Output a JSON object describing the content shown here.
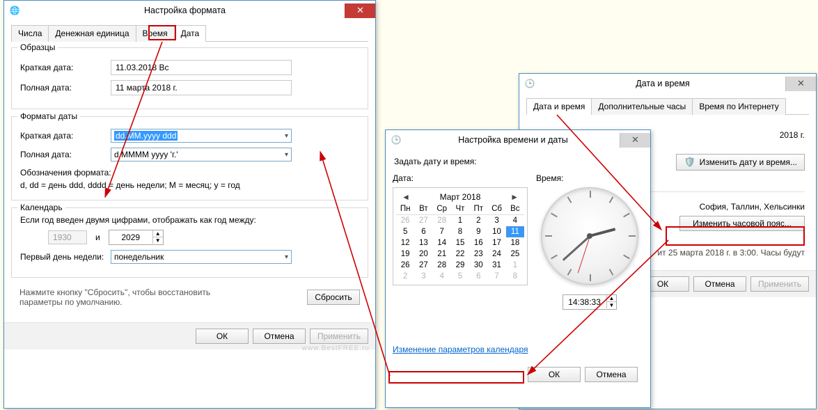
{
  "win1": {
    "title": "Настройка формата",
    "tabs": [
      "Числа",
      "Денежная единица",
      "Время",
      "Дата"
    ],
    "active_tab": 3,
    "group_samples": {
      "legend": "Образцы",
      "short_label": "Краткая дата:",
      "short_value": "11.03.2018 Вс",
      "long_label": "Полная дата:",
      "long_value": "11 марта 2018 г."
    },
    "group_formats": {
      "legend": "Форматы даты",
      "short_label": "Краткая дата:",
      "short_value": "dd.MM.yyyy ddd",
      "long_label": "Полная дата:",
      "long_value": "d MMMM yyyy 'г.'",
      "hint_label": "Обозначения формата:",
      "hint_text": "d, dd = день  ddd, dddd = день недели; M = месяц; y = год"
    },
    "group_calendar": {
      "legend": "Календарь",
      "twodigit_label": "Если год введен двумя цифрами, отображать как год между:",
      "year_from": "1930",
      "year_and": "и",
      "year_to": "2029",
      "firstday_label": "Первый день недели:",
      "firstday_value": "понедельник"
    },
    "reset_hint": "Нажмите кнопку \"Сбросить\", чтобы восстановить параметры по умолчанию.",
    "reset_btn": "Сбросить",
    "ok": "ОК",
    "cancel": "Отмена",
    "apply": "Применить"
  },
  "win2": {
    "title": "Настройка времени и даты",
    "set_label": "Задать дату и время:",
    "date_label": "Дата:",
    "time_label": "Время:",
    "month_title": "Март 2018",
    "dow": [
      "Пн",
      "Вт",
      "Ср",
      "Чт",
      "Пт",
      "Сб",
      "Вс"
    ],
    "weeks": [
      [
        {
          "d": "26",
          "out": true
        },
        {
          "d": "27",
          "out": true
        },
        {
          "d": "28",
          "out": true
        },
        {
          "d": "1"
        },
        {
          "d": "2"
        },
        {
          "d": "3"
        },
        {
          "d": "4"
        }
      ],
      [
        {
          "d": "5"
        },
        {
          "d": "6"
        },
        {
          "d": "7"
        },
        {
          "d": "8"
        },
        {
          "d": "9"
        },
        {
          "d": "10"
        },
        {
          "d": "11",
          "sel": true,
          "today": true
        }
      ],
      [
        {
          "d": "12"
        },
        {
          "d": "13"
        },
        {
          "d": "14"
        },
        {
          "d": "15"
        },
        {
          "d": "16"
        },
        {
          "d": "17"
        },
        {
          "d": "18"
        }
      ],
      [
        {
          "d": "19"
        },
        {
          "d": "20"
        },
        {
          "d": "21"
        },
        {
          "d": "22"
        },
        {
          "d": "23"
        },
        {
          "d": "24"
        },
        {
          "d": "25"
        }
      ],
      [
        {
          "d": "26"
        },
        {
          "d": "27"
        },
        {
          "d": "28"
        },
        {
          "d": "29"
        },
        {
          "d": "30"
        },
        {
          "d": "31"
        },
        {
          "d": "1",
          "out": true
        }
      ],
      [
        {
          "d": "2",
          "out": true
        },
        {
          "d": "3",
          "out": true
        },
        {
          "d": "4",
          "out": true
        },
        {
          "d": "5",
          "out": true
        },
        {
          "d": "6",
          "out": true
        },
        {
          "d": "7",
          "out": true
        },
        {
          "d": "8",
          "out": true
        }
      ]
    ],
    "time_value": "14:38:33",
    "link": "Изменение параметров календаря",
    "ok": "ОК",
    "cancel": "Отмена"
  },
  "win3": {
    "title": "Дата и время",
    "tabs": [
      "Дата и время",
      "Дополнительные часы",
      "Время по Интернету"
    ],
    "active_tab": 0,
    "date_line": "2018 г.",
    "change_btn": "Изменить дату и время...",
    "tz_line": "София, Таллин, Хельсинки",
    "change_tz_btn": "Изменить часовой пояс...",
    "dst_line": "ит 25 марта 2018 г. в 3:00. Часы будут",
    "ok": "ОК",
    "cancel": "Отмена",
    "apply": "Применить"
  },
  "watermark": "www.BestFREE.ru"
}
